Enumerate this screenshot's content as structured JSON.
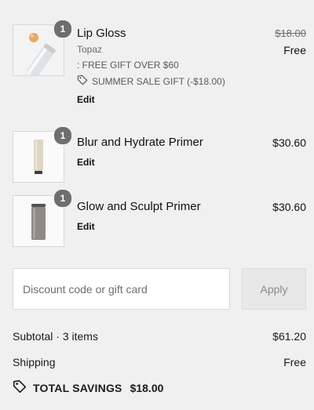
{
  "items": [
    {
      "name": "Lip Gloss",
      "variant": "Topaz",
      "quantity": "1",
      "original_price": "$18.00",
      "price": "Free",
      "promos": [
        ": FREE GIFT OVER $60",
        "SUMMER SALE GIFT (-$18.00)"
      ],
      "edit_label": "Edit"
    },
    {
      "name": "Blur and Hydrate Primer",
      "quantity": "1",
      "price": "$30.60",
      "edit_label": "Edit"
    },
    {
      "name": "Glow and Sculpt Primer",
      "quantity": "1",
      "price": "$30.60",
      "edit_label": "Edit"
    }
  ],
  "discount": {
    "placeholder": "Discount code or gift card",
    "apply_label": "Apply"
  },
  "summary": {
    "subtotal_label": "Subtotal · 3 items",
    "subtotal_value": "$61.20",
    "shipping_label": "Shipping",
    "shipping_value": "Free",
    "savings_label": "TOTAL SAVINGS",
    "savings_value": "$18.00"
  },
  "colors": {
    "background": "#f0f0f0",
    "badge": "#6e6e6e",
    "text": "#1a1a1a"
  }
}
